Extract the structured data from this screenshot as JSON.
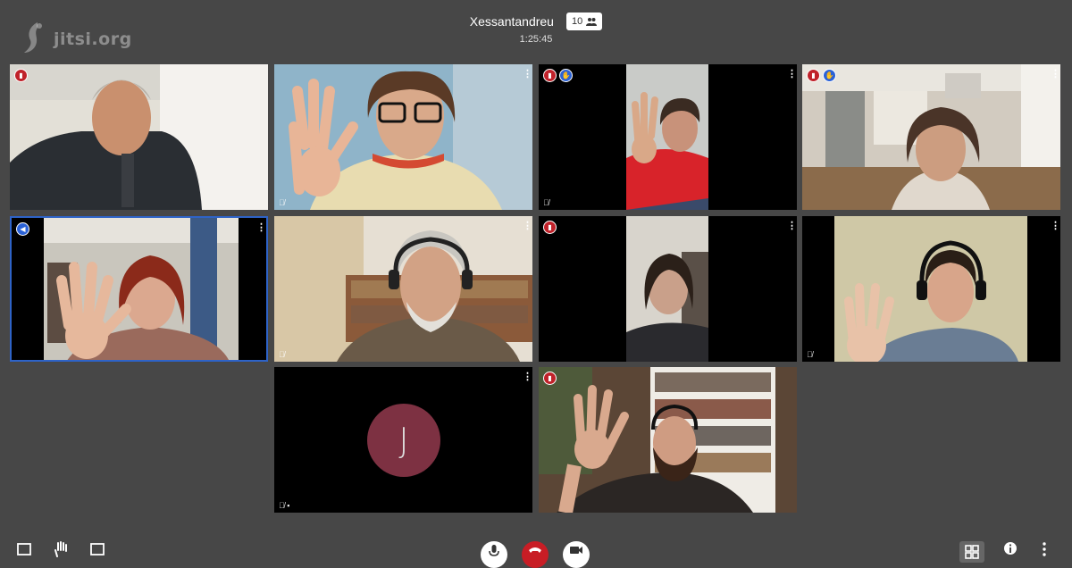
{
  "brand": {
    "logo_text": "jitsi.org"
  },
  "header": {
    "room_name": "Xessantandreu",
    "participant_count": "10",
    "timer": "1:25:45"
  },
  "avatar_initial": "J",
  "colors": {
    "background": "#474747",
    "dominant_border": "#2e63c7",
    "connection_red": "#c0222a",
    "raise_hand_blue": "#2b62d6",
    "avatar_bg": "#7d3142",
    "hangup_red": "#c81d25"
  },
  "toolbar": {
    "left": [
      "screen-share-icon",
      "raise-hand-icon",
      "chat-icon"
    ],
    "center": [
      "microphone-icon",
      "hangup-icon",
      "camera-icon"
    ],
    "right": [
      "tile-view-icon",
      "info-icon",
      "more-icon"
    ]
  }
}
